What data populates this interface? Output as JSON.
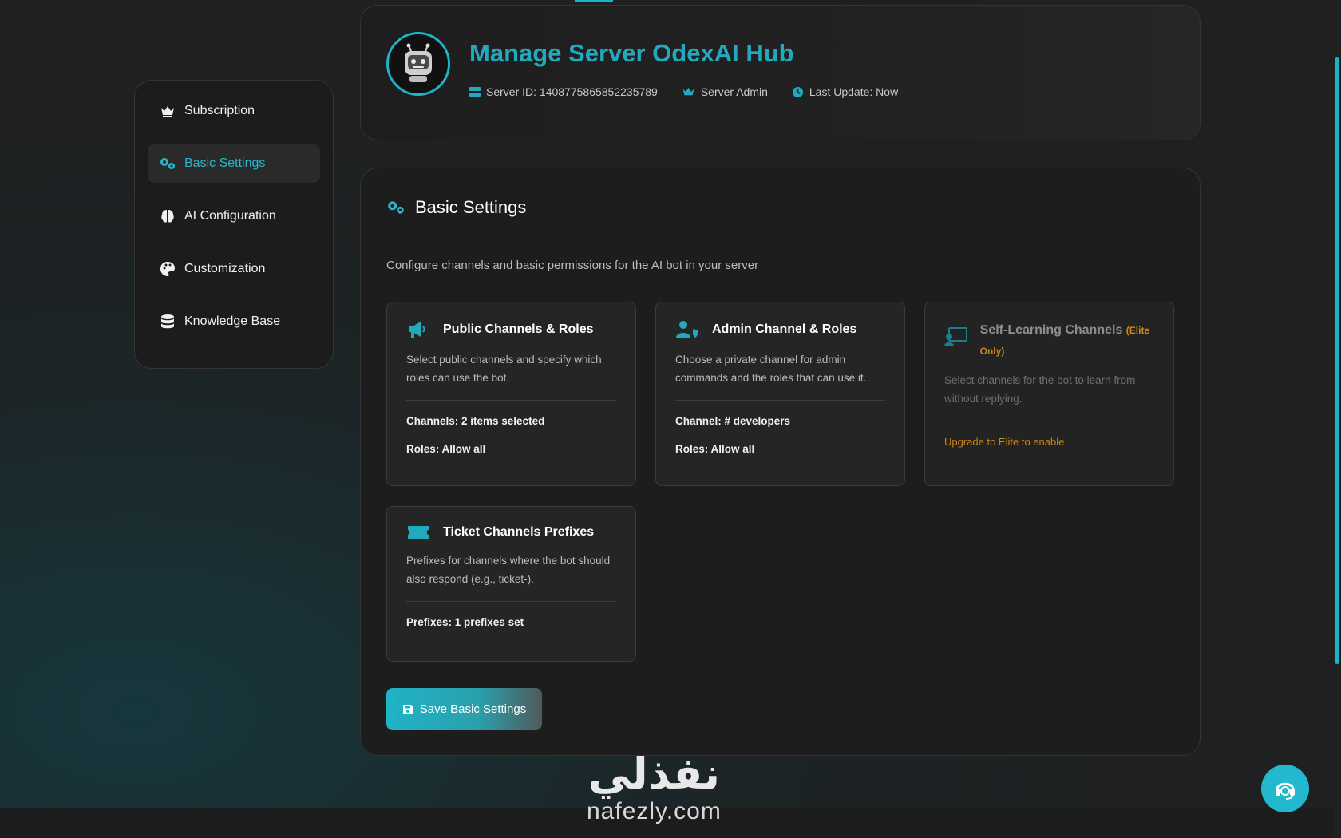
{
  "sidebar": {
    "items": [
      {
        "label": "Subscription",
        "icon": "crown-icon"
      },
      {
        "label": "Basic Settings",
        "icon": "gears-icon",
        "active": true
      },
      {
        "label": "AI Configuration",
        "icon": "brain-icon"
      },
      {
        "label": "Customization",
        "icon": "palette-icon"
      },
      {
        "label": "Knowledge Base",
        "icon": "database-icon"
      }
    ]
  },
  "header": {
    "title": "Manage Server OdexAI Hub",
    "server_id": "Server ID: 1408775865852235789",
    "role": "Server Admin",
    "last_update": "Last Update: Now"
  },
  "panel": {
    "title": "Basic Settings",
    "description": "Configure channels and basic permissions for the AI bot in your server",
    "cards": {
      "public": {
        "title": "Public Channels & Roles",
        "description": "Select public channels and specify which roles can use the bot.",
        "channels": "Channels: 2 items selected",
        "roles": "Roles: Allow all"
      },
      "admin": {
        "title": "Admin Channel & Roles",
        "description": "Choose a private channel for admin commands and the roles that can use it.",
        "channel": "Channel: # developers",
        "roles": "Roles: Allow all"
      },
      "self_learning": {
        "title": "Self-Learning Channels",
        "tag": "(Elite Only)",
        "description": "Select channels for the bot to learn from without replying.",
        "upgrade": "Upgrade to Elite to enable"
      },
      "ticket": {
        "title": "Ticket Channels Prefixes",
        "description": "Prefixes for channels where the bot should also respond (e.g., ticket-).",
        "prefixes": "Prefixes: 1 prefixes set"
      }
    },
    "save_label": "Save Basic Settings"
  },
  "watermark": {
    "logo": "نفذلي",
    "domain": "nafezly.com"
  },
  "colors": {
    "accent": "#1fb3c7",
    "warning": "#c7861b"
  }
}
